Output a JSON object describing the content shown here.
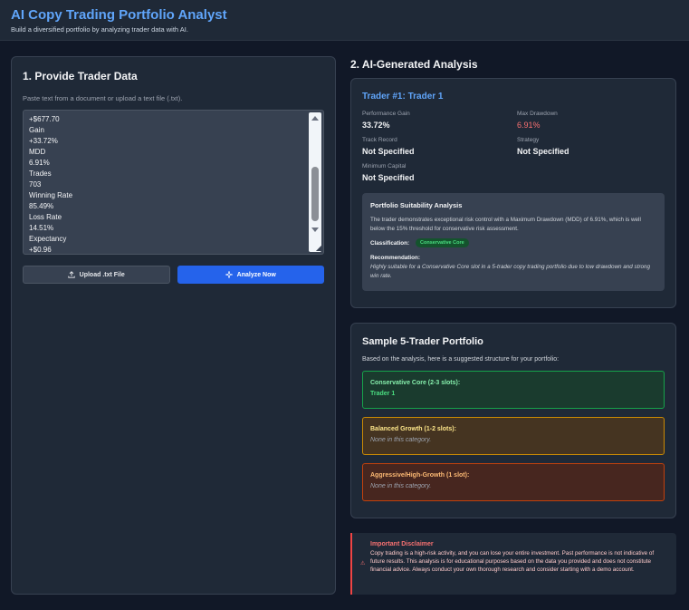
{
  "header": {
    "title": "AI Copy Trading Portfolio Analyst",
    "subtitle": "Build a diversified portfolio by analyzing trader data with AI."
  },
  "input_panel": {
    "title": "1. Provide Trader Data",
    "helper": "Paste text from a document or upload a text file (.txt).",
    "textarea_lines": [
      "+$677.70",
      "Gain",
      "+33.72%",
      "MDD",
      "6.91%",
      "Trades",
      "703",
      "Winning Rate",
      "85.49%",
      "Loss Rate",
      "14.51%",
      "Expectancy",
      "+$0.96"
    ],
    "upload_label": "Upload .txt File",
    "analyze_label": "Analyze Now"
  },
  "analysis": {
    "section_title": "2. AI-Generated Analysis",
    "trader_title": "Trader #1: Trader 1",
    "stats": {
      "performance_gain_label": "Performance Gain",
      "performance_gain": "33.72%",
      "max_drawdown_label": "Max Drawdown",
      "max_drawdown": "6.91%",
      "track_record_label": "Track Record",
      "track_record": "Not Specified",
      "strategy_label": "Strategy",
      "strategy": "Not Specified",
      "min_capital_label": "Minimum Capital",
      "min_capital": "Not Specified"
    },
    "suitability": {
      "title": "Portfolio Suitability Analysis",
      "text": "The trader demonstrates exceptional risk control with a Maximum Drawdown (MDD) of 6.91%, which is well below the 15% threshold for conservative risk assessment.",
      "classification_label": "Classification:",
      "classification": "Conservative Core",
      "recommendation_label": "Recommendation:",
      "recommendation": "Highly suitable for a Conservative Core slot in a 5-trader copy trading portfolio due to low drawdown and strong win rate."
    }
  },
  "portfolio": {
    "title": "Sample 5-Trader Portfolio",
    "subtitle": "Based on the analysis, here is a suggested structure for your portfolio:",
    "slots": [
      {
        "title": "Conservative Core (2-3 slots):",
        "value": "Trader 1"
      },
      {
        "title": "Balanced Growth (1-2 slots):",
        "value": "None in this category."
      },
      {
        "title": "Aggressive/High-Growth (1 slot):",
        "value": "None in this category."
      }
    ]
  },
  "disclaimer": {
    "icon": "warning-icon",
    "title": "Important Disclaimer",
    "text": "Copy trading is a high-risk activity, and you can lose your entire investment. Past performance is not indicative of future results. This analysis is for educational purposes based on the data you provided and does not constitute financial advice. Always conduct your own thorough research and consider starting with a demo account."
  },
  "colors": {
    "accent": "#60a5fa",
    "primary_button": "#2563eb",
    "drawdown": "#f87171",
    "conservative": "#16a34a",
    "balanced": "#ca8a04",
    "aggressive": "#c2410c"
  }
}
